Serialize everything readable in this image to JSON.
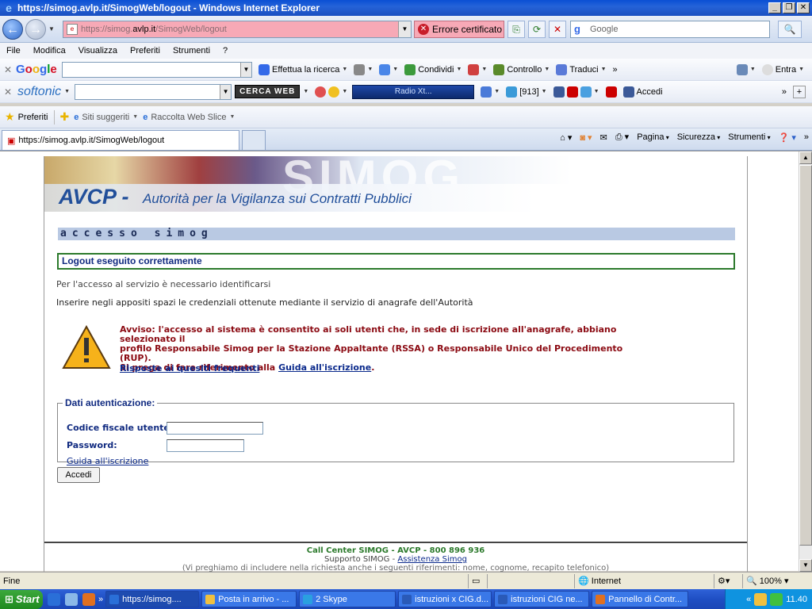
{
  "window": {
    "title": "https://simog.avlp.it/SimogWeb/logout - Windows Internet Explorer"
  },
  "address": {
    "url_prefix": "https://simog.",
    "url_domain": "avlp.it",
    "url_path": "/SimogWeb/logout",
    "cert_error": "Errore certificato",
    "search_placeholder": "Google"
  },
  "menu": [
    "File",
    "Modifica",
    "Visualizza",
    "Preferiti",
    "Strumenti",
    "?"
  ],
  "google_toolbar": {
    "search_label": "Effettua la ricerca",
    "share_label": "Condividi",
    "check_label": "Controllo",
    "translate_label": "Traduci",
    "signin_label": "Entra"
  },
  "softonic_toolbar": {
    "brand": "softonic",
    "cerca_web": "CERCA WEB",
    "radio_label": "Radio Xt...",
    "count_label": "[913]",
    "accedi_label": "Accedi"
  },
  "favorites": {
    "label": "Preferiti",
    "suggested": "Siti suggeriti",
    "webslice": "Raccolta Web Slice"
  },
  "tab": {
    "title": "https://simog.avlp.it/SimogWeb/logout"
  },
  "commands": {
    "page": "Pagina",
    "security": "Sicurezza",
    "tools": "Strumenti"
  },
  "page": {
    "banner_bg": "SIMOG",
    "banner_brand": "AVCP",
    "banner_dash": "-",
    "banner_subtitle": "Autorità per la Vigilanza sui Contratti Pubblici",
    "section_title": "accesso simog",
    "logout_message": "Logout eseguito correttamente",
    "identify_note": "Per l'accesso al servizio è necessario identificarsi",
    "credentials_note": "Inserire negli appositi spazi le credenziali ottenute mediante il servizio di anagrafe dell'Autorità",
    "warning_line1": "Avviso: l'accesso al sistema è consentito ai soli utenti che, in sede di iscrizione all'anagrafe, abbiano selezionato il",
    "warning_line2": "profilo Responsabile Simog per la Stazione Appaltante (RSSA) o Responsabile Unico del Procedimento (RUP).",
    "warning_line3_pre": "Si prega di fare riferimento alla ",
    "warning_line3_link": "Guida all'iscrizione",
    "warning_line3_post": ".",
    "faq_link": "Risposte ai quesiti frequenti",
    "auth_legend": "Dati autenticazione:",
    "cf_label": "Codice fiscale utente:",
    "pw_label": "Password:",
    "guida_link": "Guida all'iscrizione",
    "accedi_button": "Accedi",
    "footer_callcenter": "Call Center SIMOG - AVCP - 800 896 936",
    "footer_support_pre": "Supporto SIMOG - ",
    "footer_support_link": "Assistenza Simog",
    "footer_hint": "(Vi preghiamo di includere nella richiesta anche i seguenti riferimenti: nome, cognome, recapito telefonico)"
  },
  "status": {
    "left": "Fine",
    "zone": "Internet",
    "zoom": "100%"
  },
  "taskbar": {
    "start": "Start",
    "tasks": [
      "https://simog....",
      "Posta in arrivo - ...",
      "2 Skype",
      "istruzioni x CIG.d...",
      "istruzioni CIG ne...",
      "Pannello di Contr..."
    ],
    "clock": "11.40"
  },
  "colors": {
    "accent": "#214f9a",
    "warning": "#8b0a12",
    "success": "#2c7a2c",
    "section_bg": "#b9c9e3"
  }
}
